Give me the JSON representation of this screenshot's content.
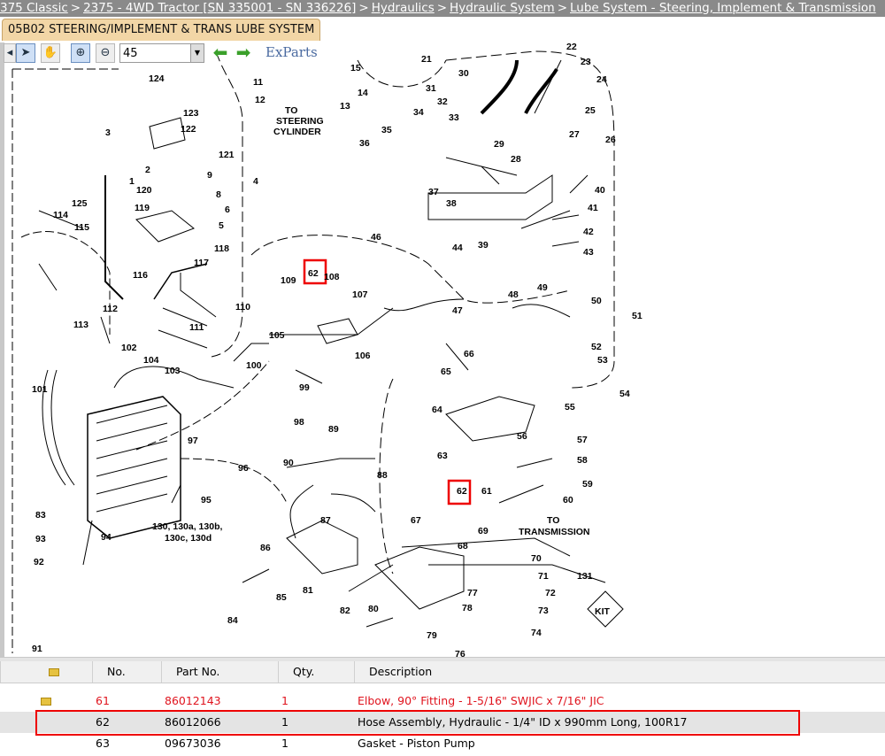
{
  "breadcrumb": [
    {
      "label": "375 Classic"
    },
    {
      "label": "2375 - 4WD Tractor [SN 335001 - SN 336226]"
    },
    {
      "label": "Hydraulics"
    },
    {
      "label": "Hydraulic System"
    },
    {
      "label": "Lube System - Steering, Implement & Transmission"
    }
  ],
  "breadcrumb_separator": ">",
  "viewer": {
    "tab_title": "05B02 STEERING/IMPLEMENT & TRANS LUBE SYSTEM",
    "zoom_value": "45",
    "logo_text": "ExParts",
    "toolbar_icons": [
      "select-arrow-icon",
      "pan-hand-icon",
      "zoom-in-icon",
      "zoom-out-icon",
      "back-arrow-icon",
      "forward-arrow-icon"
    ]
  },
  "diagram": {
    "text_labels": {
      "steering_1": "TO",
      "steering_2": "STEERING",
      "steering_3": "CYLINDER",
      "trans_1": "TO",
      "trans_2": "TRANSMISSION",
      "kit": "KIT",
      "callout_130_1": "130, 130a, 130b,",
      "callout_130_2": "130c, 130d"
    },
    "callouts": [
      "1",
      "2",
      "3",
      "4",
      "5",
      "6",
      "8",
      "9",
      "11",
      "12",
      "13",
      "14",
      "15",
      "21",
      "22",
      "23",
      "24",
      "25",
      "26",
      "27",
      "28",
      "29",
      "30",
      "31",
      "32",
      "33",
      "34",
      "35",
      "36",
      "37",
      "38",
      "39",
      "40",
      "41",
      "42",
      "43",
      "44",
      "46",
      "47",
      "48",
      "49",
      "50",
      "51",
      "52",
      "53",
      "54",
      "55",
      "56",
      "57",
      "58",
      "59",
      "60",
      "61",
      "62",
      "63",
      "64",
      "65",
      "66",
      "67",
      "68",
      "69",
      "70",
      "71",
      "72",
      "73",
      "74",
      "76",
      "77",
      "78",
      "79",
      "80",
      "81",
      "82",
      "83",
      "84",
      "85",
      "86",
      "87",
      "88",
      "89",
      "90",
      "91",
      "92",
      "93",
      "94",
      "95",
      "96",
      "97",
      "98",
      "99",
      "100",
      "101",
      "102",
      "103",
      "104",
      "105",
      "106",
      "107",
      "108",
      "109",
      "110",
      "111",
      "112",
      "113",
      "114",
      "115",
      "116",
      "117",
      "118",
      "119",
      "120",
      "121",
      "122",
      "123",
      "124",
      "125",
      "131"
    ],
    "highlighted_callout": "62"
  },
  "parts_table": {
    "columns": [
      "",
      "No.",
      "Part No.",
      "Qty.",
      "Description"
    ],
    "rows": [
      {
        "no": "61",
        "part_no": "86012143",
        "qty": "1",
        "description": "Elbow, 90° Fitting - 1-5/16\" SWJIC x 7/16\" JIC",
        "status_color": "#e0141e"
      },
      {
        "no": "62",
        "part_no": "86012066",
        "qty": "1",
        "description": "Hose Assembly, Hydraulic - 1/4\" ID x 990mm Long, 100R17",
        "selected": true
      },
      {
        "no": "63",
        "part_no": "09673036",
        "qty": "1",
        "description": "Gasket - Piston Pump"
      }
    ]
  }
}
